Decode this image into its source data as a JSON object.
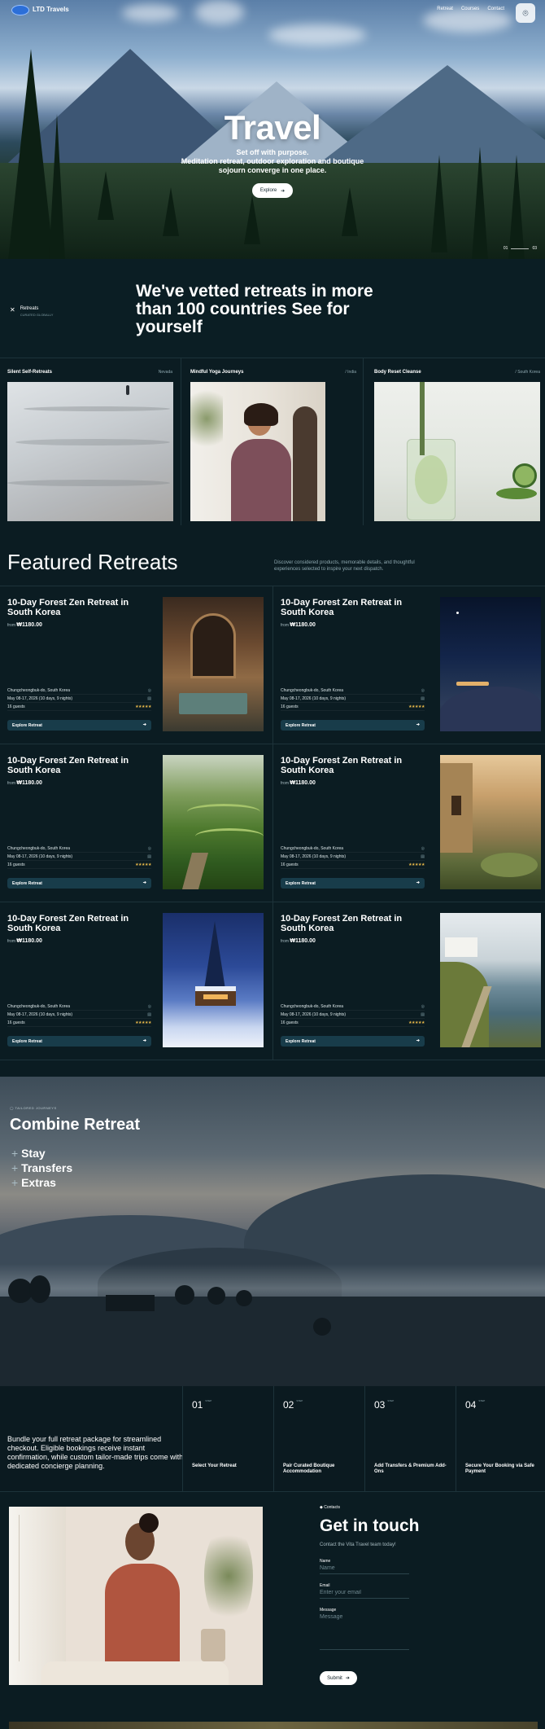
{
  "nav": {
    "brand": "LTD Travels",
    "links": [
      "Retreat",
      "Courses",
      "Contact"
    ],
    "camera_icon": "camera-icon"
  },
  "hero": {
    "title": "Travel",
    "subtitle": "Set off with purpose.\nMeditation retreat, outdoor exploration and boutique sojourn converge in one place.",
    "button": "Explore",
    "slide_current": "01",
    "slide_total": "03"
  },
  "vetted": {
    "tag_title": "Retreats",
    "tag_sub": "CURATED GLOBALLY",
    "heading": "We've vetted retreats in more than 100 countries See for yourself"
  },
  "trio": [
    {
      "label": "Silent Self-Retreats",
      "location": "Nevada"
    },
    {
      "label": "Mindful Yoga Journeys",
      "location": "/ India"
    },
    {
      "label": "Body Reset Cleanse",
      "location": "/ South Korea"
    }
  ],
  "featured": {
    "heading": "Featured Retreats",
    "description": "Discover considered products, memorable details, and thoughtful experiences selected to inspire your next dispatch.",
    "cards": [
      {
        "title": "10-Day Forest Zen Retreat in South Korea",
        "price_prefix": "from",
        "price": "₩1180.00",
        "location": "Chungcheongbuk-do, South Korea",
        "dates": "May 08-17, 2026 (10 days, 9 nights)",
        "guests": "16 guests",
        "button": "Explore Retreat"
      },
      {
        "title": "10-Day Forest Zen Retreat in South Korea",
        "price_prefix": "from",
        "price": "₩1180.00",
        "location": "Chungcheongbuk-do, South Korea",
        "dates": "May 08-17, 2026 (10 days, 9 nights)",
        "guests": "16 guests",
        "button": "Explore Retreat"
      },
      {
        "title": "10-Day Forest Zen Retreat in South Korea",
        "price_prefix": "from",
        "price": "₩1180.00",
        "location": "Chungcheongbuk-do, South Korea",
        "dates": "May 08-17, 2026 (10 days, 9 nights)",
        "guests": "16 guests",
        "button": "Explore Retreat"
      },
      {
        "title": "10-Day Forest Zen Retreat in South Korea",
        "price_prefix": "from",
        "price": "₩1180.00",
        "location": "Chungcheongbuk-do, South Korea",
        "dates": "May 08-17, 2026 (10 days, 9 nights)",
        "guests": "16 guests",
        "button": "Explore Retreat"
      },
      {
        "title": "10-Day Forest Zen Retreat in South Korea",
        "price_prefix": "from",
        "price": "₩1180.00",
        "location": "Chungcheongbuk-do, South Korea",
        "dates": "May 08-17, 2026 (10 days, 9 nights)",
        "guests": "16 guests",
        "button": "Explore Retreat"
      },
      {
        "title": "10-Day Forest Zen Retreat in South Korea",
        "price_prefix": "from",
        "price": "₩1180.00",
        "location": "Chungcheongbuk-do, South Korea",
        "dates": "May 08-17, 2026 (10 days, 9 nights)",
        "guests": "16 guests",
        "button": "Explore Retreat"
      }
    ],
    "rating_stars": "★★★★★"
  },
  "combine": {
    "tag": "TAILORED JOURNEYS",
    "heading": "Combine Retreat",
    "items": [
      "Stay",
      "Transfers",
      "Extras"
    ]
  },
  "steps": {
    "description": "Bundle your full retreat package for streamlined checkout. Eligible bookings receive instant confirmation, while custom tailor-made trips come with dedicated concierge planning.",
    "items": [
      {
        "num": "01",
        "sup": "STEP",
        "label": "Select Your Retreat"
      },
      {
        "num": "02",
        "sup": "STEP",
        "label": "Pair Curated Boutique Accommodation"
      },
      {
        "num": "03",
        "sup": "STEP",
        "label": "Add Transfers & Premium Add-Ons"
      },
      {
        "num": "04",
        "sup": "STEP",
        "label": "Secure Your Booking via Safe Payment"
      }
    ]
  },
  "contact": {
    "tag": "Contacts",
    "heading": "Get in touch",
    "subtitle": "Contact the Vita Travel team today!",
    "name_label": "Name",
    "name_placeholder": "Name",
    "email_label": "Email",
    "email_placeholder": "Enter your email",
    "message_label": "Message",
    "message_placeholder": "Message",
    "submit": "Submit"
  },
  "colors": {
    "background": "#0b1c22",
    "button_dark": "#183c4a",
    "star": "#e9b94a",
    "brand": "#2c6fd8"
  }
}
